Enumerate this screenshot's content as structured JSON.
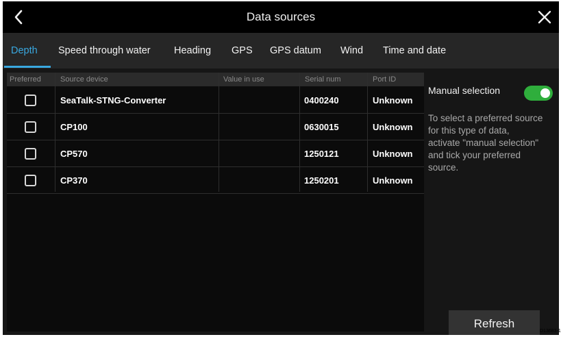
{
  "header": {
    "title": "Data sources",
    "back_icon": "chevron-left-icon",
    "close_icon": "close-icon"
  },
  "tabs": [
    {
      "label": "Depth",
      "active": true
    },
    {
      "label": "Speed through water",
      "active": false
    },
    {
      "label": "Heading",
      "active": false
    },
    {
      "label": "GPS",
      "active": false
    },
    {
      "label": "GPS datum",
      "active": false
    },
    {
      "label": "Wind",
      "active": false
    },
    {
      "label": "Time and date",
      "active": false
    }
  ],
  "table": {
    "columns": [
      "Preferred",
      "Source device",
      "Value in use",
      "Serial num",
      "Port ID"
    ],
    "rows": [
      {
        "preferred": false,
        "source": "SeaTalk-STNG-Converter",
        "value": "",
        "serial": "0400240",
        "port": "Unknown"
      },
      {
        "preferred": false,
        "source": "CP100",
        "value": "",
        "serial": "0630015",
        "port": "Unknown"
      },
      {
        "preferred": false,
        "source": "CP570",
        "value": "",
        "serial": "1250121",
        "port": "Unknown"
      },
      {
        "preferred": false,
        "source": "CP370",
        "value": "",
        "serial": "1250201",
        "port": "Unknown"
      }
    ]
  },
  "side": {
    "manual_label": "Manual selection",
    "manual_on": true,
    "help_lines": [
      "To select a preferred source",
      "for this type of data,",
      "activate \"manual selection\"",
      "and tick your preferred",
      "source."
    ],
    "refresh_label": "Refresh"
  },
  "image_code": "D13683-1",
  "colors": {
    "accent": "#39a8e0",
    "toggle_on": "#2fae3c",
    "background": "#161616"
  }
}
